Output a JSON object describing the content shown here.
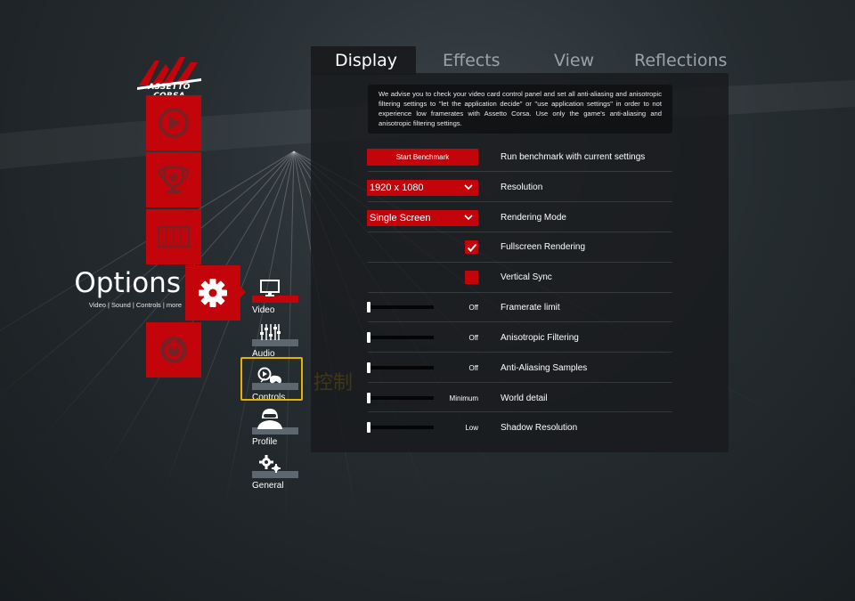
{
  "brand": {
    "logo_text": "ASSETTO CORSA",
    "accent": "#c3050b",
    "highlight": "#e8b100"
  },
  "side_menu": {
    "items": [
      {
        "name": "drive",
        "icon": "play-wheel-icon"
      },
      {
        "name": "career",
        "icon": "trophy-icon"
      },
      {
        "name": "replay",
        "icon": "film-strip-icon"
      },
      {
        "name": "options",
        "icon": "gear-icon"
      },
      {
        "name": "quit",
        "icon": "power-icon"
      }
    ],
    "options_title": "Options",
    "options_subtitle": "Video | Sound | Controls | more"
  },
  "submenu": {
    "video": "Video",
    "audio": "Audio",
    "controls": "Controls",
    "profile": "Profile",
    "general": "General"
  },
  "hover_label": "控制",
  "tabs": {
    "display": "Display",
    "effects": "Effects",
    "view": "View",
    "reflections": "Reflections"
  },
  "advice": "We advise you to check your video card control panel and set all anti-aliasing and anisotropic filtering settings to \"let the application decide\" or \"use application settings\" in order to not experience low framerates with Assetto Corsa. Use only the game's anti-aliasing and anisotropic filtering settings.",
  "settings": {
    "benchmark": {
      "button": "Start Benchmark",
      "label": "Run benchmark with current settings"
    },
    "resolution": {
      "value": "1920 x 1080",
      "label": "Resolution"
    },
    "rendering_mode": {
      "value": "Single Screen",
      "label": "Rendering Mode"
    },
    "fullscreen": {
      "label": "Fullscreen Rendering",
      "checked": true
    },
    "vsync": {
      "label": "Vertical Sync",
      "checked": false
    },
    "framerate_limit": {
      "label": "Framerate limit",
      "value": "Off",
      "level": 0
    },
    "anisotropic": {
      "label": "Anisotropic Filtering",
      "value": "Off",
      "level": 0
    },
    "antialiasing": {
      "label": "Anti-Aliasing Samples",
      "value": "Off",
      "level": 0
    },
    "world_detail": {
      "label": "World detail",
      "value": "Minimum",
      "level": 0
    },
    "shadow_resolution": {
      "label": "Shadow Resolution",
      "value": "Low",
      "level": 0
    }
  }
}
